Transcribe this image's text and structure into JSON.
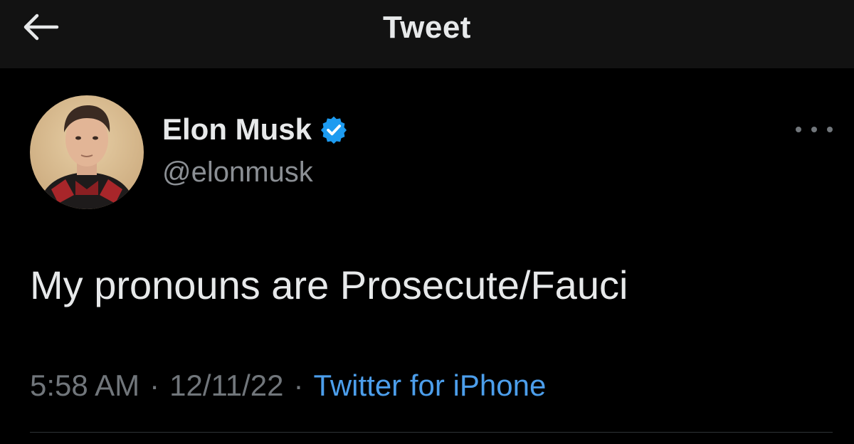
{
  "header": {
    "title": "Tweet",
    "back_icon": "arrow-left-icon"
  },
  "author": {
    "name": "Elon Musk",
    "handle": "@elonmusk",
    "verified_icon": "verified-badge-icon",
    "verified_color": "#1d9bf0"
  },
  "tweet": {
    "text": "My pronouns are Prosecute/Fauci",
    "time": "5:58 AM",
    "date": "12/11/22",
    "separator": "·",
    "source": "Twitter for iPhone"
  },
  "more_icon": "more-horizontal-icon",
  "colors": {
    "background": "#000000",
    "header_background": "#121212",
    "text_primary": "#e7e9ea",
    "text_muted": "#71767b",
    "link": "#4c9eeb"
  }
}
